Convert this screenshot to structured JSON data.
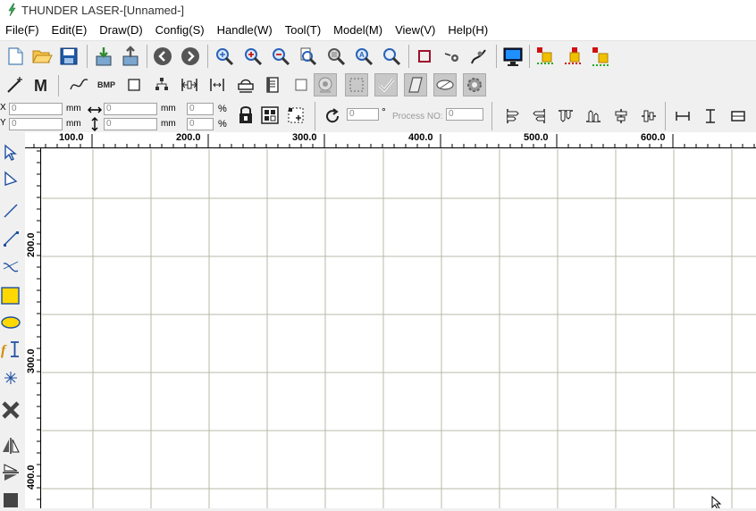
{
  "window": {
    "title": "THUNDER LASER-[Unnamed-]"
  },
  "menu": [
    {
      "label": "File(F)"
    },
    {
      "label": "Edit(E)"
    },
    {
      "label": "Draw(D)"
    },
    {
      "label": "Config(S)"
    },
    {
      "label": "Handle(W)"
    },
    {
      "label": "Tool(T)"
    },
    {
      "label": "Model(M)"
    },
    {
      "label": "View(V)"
    },
    {
      "label": "Help(H)"
    }
  ],
  "toolbar2": {
    "bmp_label": "BMP"
  },
  "params": {
    "x_value": "0",
    "y_value": "0",
    "x_unit": "mm",
    "y_unit": "mm",
    "w_value": "0",
    "h_value": "0",
    "w_unit": "mm",
    "h_unit": "mm",
    "wp_value": "0",
    "hp_value": "0",
    "percent": "%",
    "angle_value": "0",
    "degree": "°",
    "process_no_label": "Process NO:",
    "process_no_value": "0"
  },
  "ruler": {
    "h_labels": [
      "100.0",
      "200.0",
      "300.0",
      "400.0",
      "500.0",
      "600.0"
    ],
    "v_labels": [
      "200.0",
      "300.0",
      "400.0"
    ]
  },
  "colors": {
    "grid": "#b9b9a9",
    "accent_yellow": "#ffd800",
    "canvas_bg": "#ffffff"
  }
}
